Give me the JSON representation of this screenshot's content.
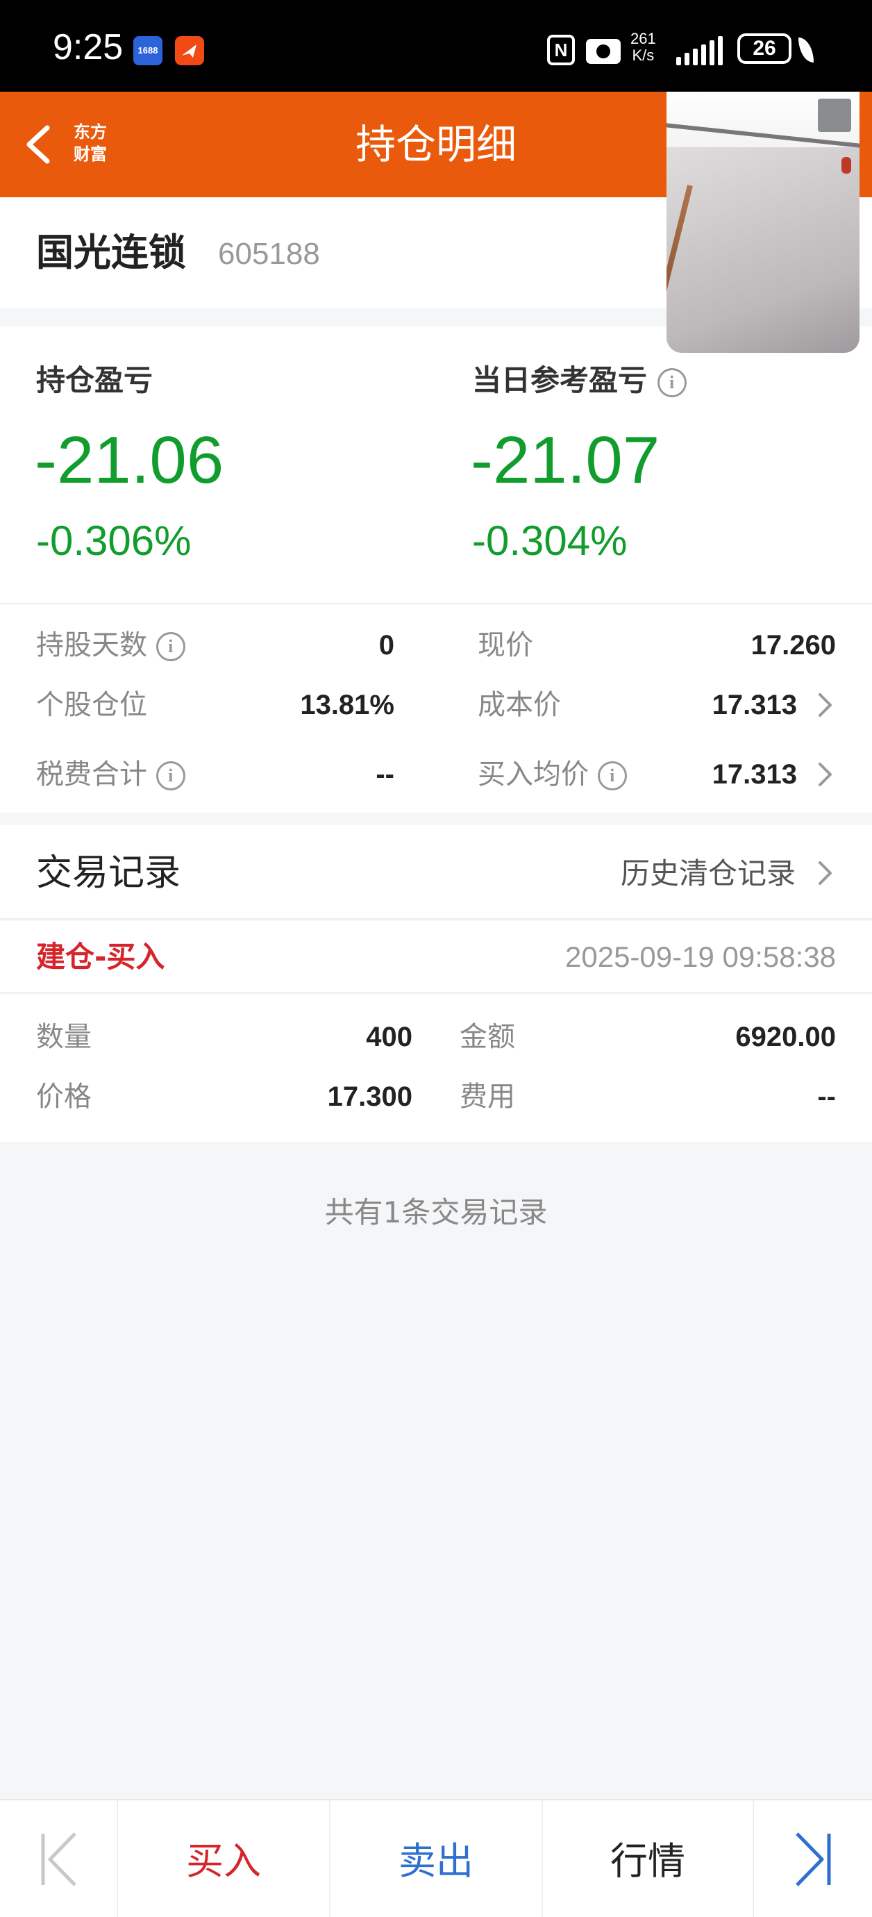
{
  "status_bar": {
    "time": "9:25",
    "app1_label": "1688",
    "net_speed_value": "261",
    "net_speed_unit": "K/s",
    "battery": "26",
    "nfc_label": "N"
  },
  "header": {
    "title": "持仓明细",
    "brand_line1": "东方",
    "brand_line2": "财富",
    "color": "#ea5a0c"
  },
  "stock": {
    "name": "国光连锁",
    "code": "605188"
  },
  "pnl": {
    "position_label": "持仓盈亏",
    "position_value": "-21.06",
    "position_pct": "-0.306%",
    "daily_label": "当日参考盈亏",
    "daily_value": "-21.07",
    "daily_pct": "-0.304%",
    "loss_color": "#119d2d"
  },
  "stats": {
    "hold_days_label": "持股天数",
    "hold_days_value": "0",
    "current_price_label": "现价",
    "current_price_value": "17.260",
    "position_ratio_label": "个股仓位",
    "position_ratio_value": "13.81%",
    "cost_price_label": "成本价",
    "cost_price_value": "17.313",
    "tax_label": "税费合计",
    "tax_value": "--",
    "avg_buy_label": "买入均价",
    "avg_buy_value": "17.313"
  },
  "trade_records": {
    "title": "交易记录",
    "history_link": "历史清仓记录",
    "records": [
      {
        "type": "建仓-买入",
        "time": "2025-09-19 09:58:38",
        "qty_label": "数量",
        "qty": "400",
        "amount_label": "金额",
        "amount": "6920.00",
        "price_label": "价格",
        "price": "17.300",
        "fee_label": "费用",
        "fee": "--"
      }
    ],
    "summary": "共有1条交易记录"
  },
  "bottom_bar": {
    "buy": "买入",
    "sell": "卖出",
    "quote": "行情",
    "buy_color": "#d6242b",
    "sell_color": "#2e6fcf"
  }
}
